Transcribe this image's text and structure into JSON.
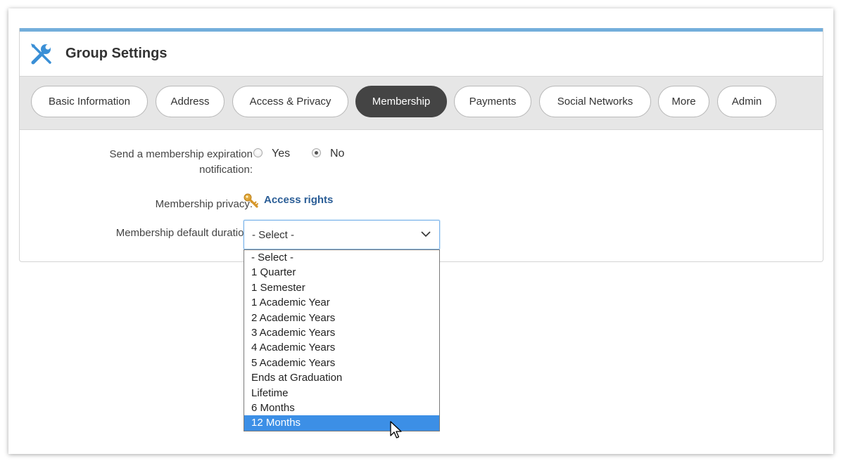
{
  "header": {
    "title": "Group Settings",
    "icon": "tools-icon",
    "accent_color": "#73aedb"
  },
  "tabs": [
    {
      "label": "Basic Information",
      "active": false
    },
    {
      "label": "Address",
      "active": false
    },
    {
      "label": "Access & Privacy",
      "active": false
    },
    {
      "label": "Membership",
      "active": true
    },
    {
      "label": "Payments",
      "active": false
    },
    {
      "label": "Social Networks",
      "active": false
    },
    {
      "label": "More",
      "active": false
    },
    {
      "label": "Admin",
      "active": false
    }
  ],
  "form": {
    "expiration": {
      "label_line1": "Send a membership expiration",
      "label_line2": "notification:",
      "yes_label": "Yes",
      "no_label": "No",
      "selected": "No"
    },
    "privacy": {
      "label": "Membership privacy:",
      "link_label": "Access rights",
      "icon": "key-icon"
    },
    "duration": {
      "label": "Membership default duration:",
      "selected_value": "- Select -",
      "options": [
        "- Select -",
        "1 Quarter",
        "1 Semester",
        "1 Academic Year",
        "2 Academic Years",
        "3 Academic Years",
        "4 Academic Years",
        "5 Academic Years",
        "Ends at Graduation",
        "Lifetime",
        "6 Months",
        "12 Months"
      ],
      "highlighted_option": "12 Months"
    }
  },
  "colors": {
    "active_tab": "#444444",
    "highlight": "#3c8fe6",
    "link": "#2a5d96"
  }
}
